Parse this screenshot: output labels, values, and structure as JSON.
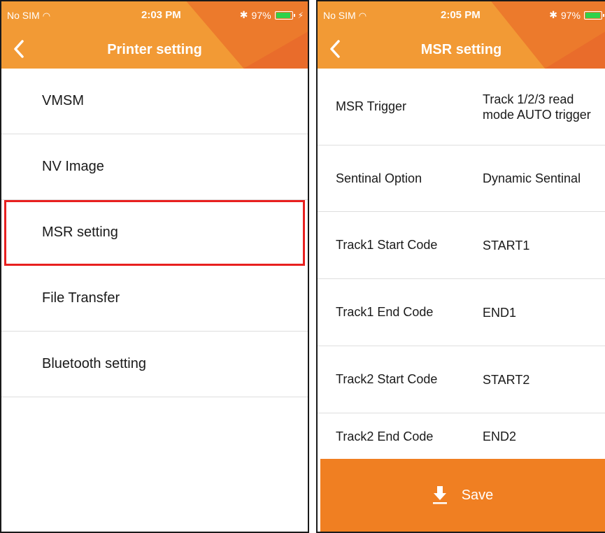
{
  "colors": {
    "accent": "#f29a35",
    "accent_dark": "#ec7a2c",
    "save": "#f07f22",
    "highlight": "#e8201f"
  },
  "left_screen": {
    "status": {
      "carrier": "No SIM",
      "time": "2:03 PM",
      "battery": "97%"
    },
    "title": "Printer setting",
    "menu": [
      {
        "label": "VMSM"
      },
      {
        "label": "NV Image"
      },
      {
        "label": "MSR setting"
      },
      {
        "label": "File Transfer"
      },
      {
        "label": "Bluetooth setting"
      }
    ]
  },
  "right_screen": {
    "status": {
      "carrier": "No SIM",
      "time": "2:05 PM",
      "battery": "97%"
    },
    "title": "MSR setting",
    "rows": [
      {
        "label": "MSR Trigger",
        "value": "Track 1/2/3 read mode AUTO trigger"
      },
      {
        "label": "Sentinal Option",
        "value": "Dynamic Sentinal"
      },
      {
        "label": "Track1 Start Code",
        "value": "START1"
      },
      {
        "label": "Track1 End Code",
        "value": "END1"
      },
      {
        "label": "Track2 Start Code",
        "value": "START2"
      },
      {
        "label": "Track2 End Code",
        "value": "END2"
      }
    ],
    "save_label": "Save"
  }
}
